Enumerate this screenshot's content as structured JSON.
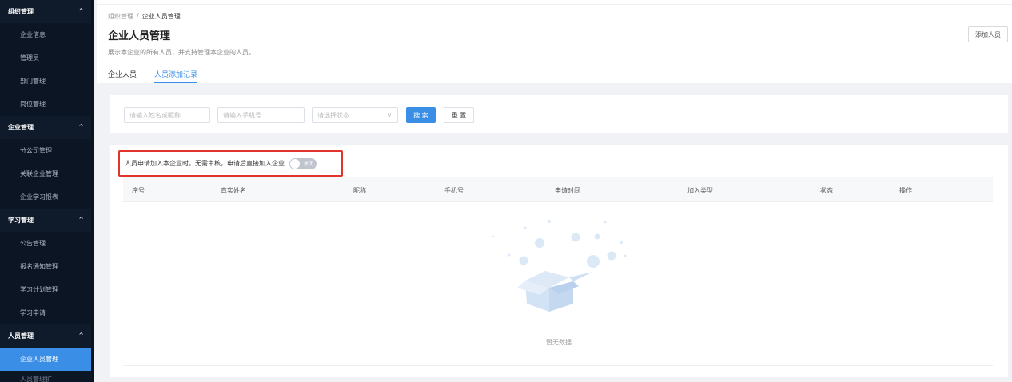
{
  "sidebar": {
    "groups": [
      {
        "title": "组织管理",
        "items": [
          "企业信息",
          "管理员",
          "部门管理",
          "岗位管理"
        ]
      },
      {
        "title": "企业管理",
        "items": [
          "分公司管理",
          "关联企业管理",
          "企业学习报表"
        ]
      },
      {
        "title": "学习管理",
        "items": [
          "公告管理",
          "报名通知管理",
          "学习计划管理",
          "学习申请"
        ]
      },
      {
        "title": "人员管理",
        "items": [
          "企业人员管理",
          "人员管理扩"
        ]
      }
    ],
    "active_item": "企业人员管理"
  },
  "breadcrumb": {
    "parent": "组织管理",
    "separator": "/",
    "current": "企业人员管理"
  },
  "header": {
    "title": "企业人员管理",
    "description": "展示本企业的所有人员，并支持管理本企业的人员。",
    "add_button": "添加人员"
  },
  "tabs": [
    {
      "label": "企业人员",
      "active": false
    },
    {
      "label": "人员添加记录",
      "active": true
    }
  ],
  "filters": {
    "name_placeholder": "请输入姓名或昵称",
    "phone_placeholder": "请输入手机号",
    "status_placeholder": "请选择状态",
    "search_label": "搜 索",
    "reset_label": "重 置"
  },
  "notice": {
    "text": "人员申请加入本企业时，无需审核，申请后直接加入企业",
    "toggle_label": "关闭",
    "toggle_on": false
  },
  "table": {
    "columns": [
      "序号",
      "真实姓名",
      "昵称",
      "手机号",
      "申请时间",
      "加入类型",
      "状态",
      "操作"
    ],
    "rows": [],
    "empty_text": "暂无数据"
  },
  "colors": {
    "sidebar_bg": "#0f1b2b",
    "accent": "#3a8ee6",
    "highlight_border": "#e0342c"
  }
}
